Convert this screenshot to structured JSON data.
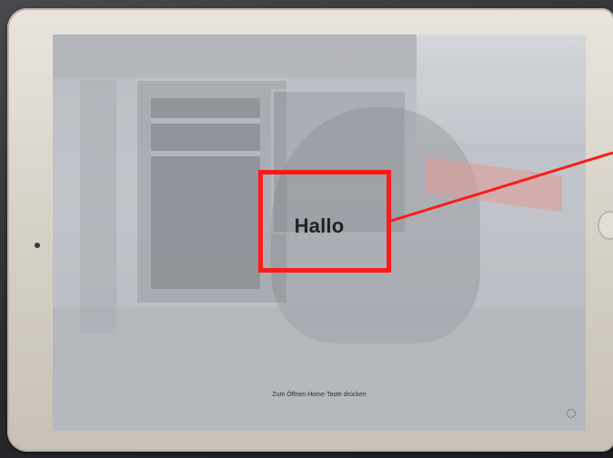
{
  "screen": {
    "greeting_text": "Hallo",
    "home_hint": "Zum Öffnen Home-Taste drücken"
  },
  "annotation": {
    "highlight_color": "#ff1a1a",
    "target": "greeting_text"
  },
  "icons": {
    "home_button": "home-button-icon",
    "front_camera": "front-camera-icon"
  }
}
